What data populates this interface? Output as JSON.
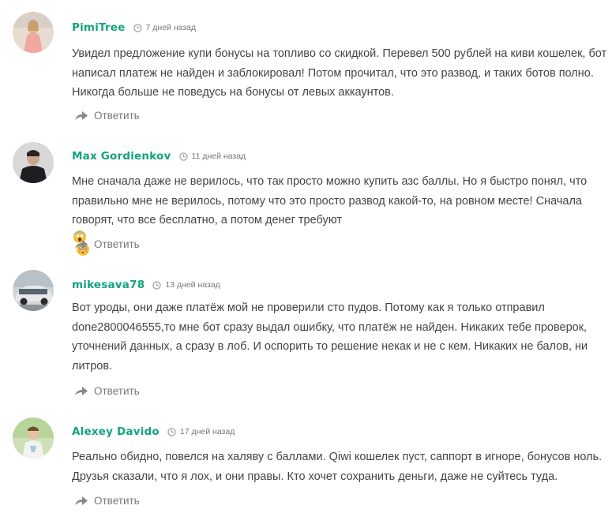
{
  "reply_label": "Ответить",
  "accent_color": "#14a37f",
  "icons": {
    "clock": "clock-icon",
    "reply": "reply-arrow-icon"
  },
  "comments": [
    {
      "author": "PimiTree",
      "date": "7 дней назад",
      "lines": [
        "Увидел предложение купи бонусы на топливо со скидкой. Перевел 500 рублей на киви кошелек, бот",
        "написал платеж не найден и заблокировал! Потом прочитал, что это развод, и таких ботов полно.",
        "Никогда больше не поведусь на бонусы от левых аккаунтов."
      ]
    },
    {
      "author": "Max Gordienkov",
      "date": "11 дней назад",
      "lines": [
        "Мне сначала даже не верилось, что так просто можно купить азс баллы. Но я быстро понял, что",
        "правильно мне не верилось, потому что это просто развод какой-то, на ровном месте! Сначала",
        "говорят, что все бесплатно, а потом денег требуют"
      ],
      "emojis": [
        "face-screaming-in-fear",
        "flushed-face"
      ]
    },
    {
      "author": "mikesava78",
      "date": "13 дней назад",
      "lines": [
        "Вот уроды, они даже платёж мой не проверили сто пудов. Потому как я только отправил",
        "done2800046555,то мне бот сразу выдал ошибку, что платёж не найден. Никаких тебе проверок,",
        "уточнений данных, а сразу в лоб. И оспорить то решение некак и не с кем. Никаких не балов, ни",
        "литров."
      ]
    },
    {
      "author": "Alexey Davido",
      "date": "17 дней назад",
      "lines": [
        "Реально обидно, повелся на халяву с баллами. Qiwi кошелек пуст, саппорт в игноре, бонусов ноль.",
        "Друзья сказали, что я лох, и они правы. Кто хочет сохранить деньги, даже не суйтесь туда."
      ]
    }
  ]
}
